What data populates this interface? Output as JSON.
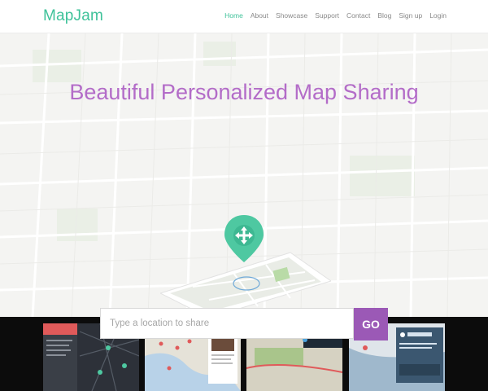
{
  "header": {
    "logo": "MapJam",
    "nav": [
      {
        "label": "Home",
        "active": true
      },
      {
        "label": "About",
        "active": false
      },
      {
        "label": "Showcase",
        "active": false
      },
      {
        "label": "Support",
        "active": false
      },
      {
        "label": "Contact",
        "active": false
      },
      {
        "label": "Blog",
        "active": false
      },
      {
        "label": "Sign up",
        "active": false
      },
      {
        "label": "Login",
        "active": false
      }
    ]
  },
  "hero": {
    "headline": "Beautiful Personalized Map Sharing"
  },
  "search": {
    "placeholder": "Type a location to share",
    "button_label": "GO"
  },
  "showcase": {
    "cards": [
      {
        "title": "MapJam",
        "icon": "map-pin-icon"
      },
      {
        "title": "",
        "icon": "map-pin-icon"
      },
      {
        "title": "GOLDEN GATE PARK",
        "icon": "map-pin-icon"
      },
      {
        "title": "Flock 2015",
        "subtitle": "Learn how to build the best apps",
        "icon": "twitter-icon"
      }
    ]
  },
  "colors": {
    "brand_green": "#3fc29a",
    "headline_purple": "#b36cc8",
    "go_purple": "#9b59b6"
  }
}
